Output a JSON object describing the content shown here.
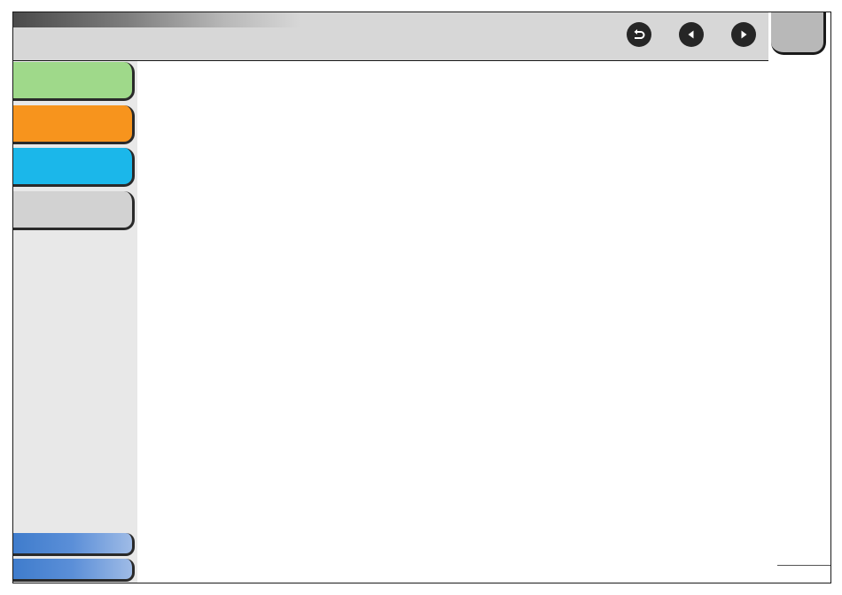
{
  "header": {
    "nav_buttons": [
      {
        "icon": "back-icon"
      },
      {
        "icon": "previous-icon"
      },
      {
        "icon": "next-icon"
      }
    ]
  },
  "sidebar": {
    "tabs": [
      {
        "color": "#9fd98a"
      },
      {
        "color": "#f7941d"
      },
      {
        "color": "#1bb7ea"
      },
      {
        "color": "#d2d2d2"
      }
    ],
    "bottom_tabs": [
      {
        "color": "#5b8fd8"
      },
      {
        "color": "#5b8fd8"
      }
    ]
  },
  "colors": {
    "header_bg": "#d7d7d7",
    "sidebar_bg": "#e8e8e8",
    "corner_tab": "#b8b8b8"
  }
}
